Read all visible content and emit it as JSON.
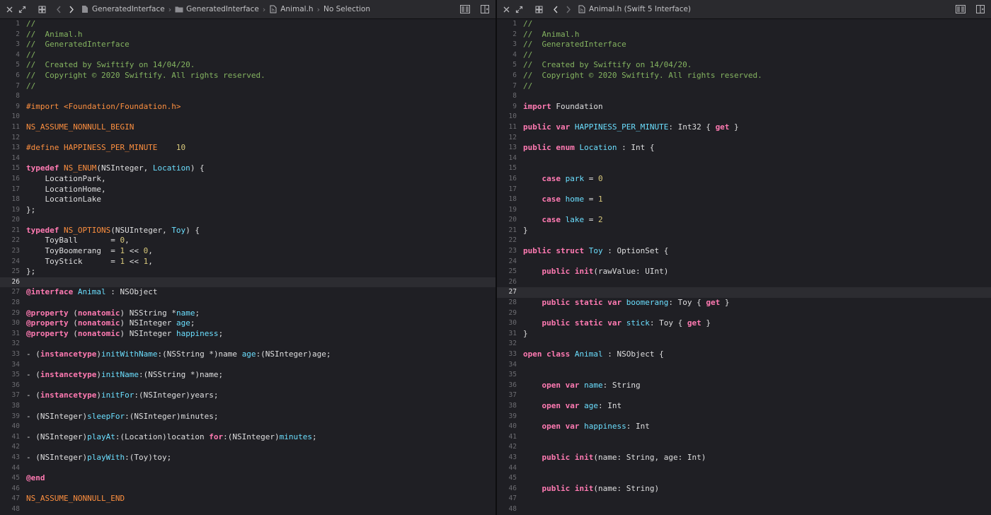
{
  "colors": {
    "background": "#1f1f24",
    "comment": "#84b360",
    "keyword": "#ff7ab2",
    "preprocessor": "#fd8f3f",
    "type": "#dabaff",
    "class": "#6bdfff",
    "number": "#d9c97c",
    "function": "#67b7a4"
  },
  "left": {
    "breadcrumbs": [
      "GeneratedInterface",
      "GeneratedInterface",
      "Animal.h",
      "No Selection"
    ],
    "current_line": 26,
    "lines": [
      {
        "n": "1",
        "s": [
          [
            "c",
            "//"
          ]
        ]
      },
      {
        "n": "2",
        "s": [
          [
            "c",
            "//  Animal.h"
          ]
        ]
      },
      {
        "n": "3",
        "s": [
          [
            "c",
            "//  GeneratedInterface"
          ]
        ]
      },
      {
        "n": "4",
        "s": [
          [
            "c",
            "//"
          ]
        ]
      },
      {
        "n": "5",
        "s": [
          [
            "c",
            "//  Created by Swiftify on 14/04/20."
          ]
        ]
      },
      {
        "n": "6",
        "s": [
          [
            "c",
            "//  Copyright © 2020 Swiftify. All rights reserved."
          ]
        ]
      },
      {
        "n": "7",
        "s": [
          [
            "c",
            "//"
          ]
        ]
      },
      {
        "n": "8",
        "s": []
      },
      {
        "n": "9",
        "s": [
          [
            "p",
            "#import <Foundation/Foundation.h>"
          ]
        ]
      },
      {
        "n": "10",
        "s": []
      },
      {
        "n": "11",
        "s": [
          [
            "p",
            "NS_ASSUME_NONNULL_BEGIN"
          ]
        ]
      },
      {
        "n": "12",
        "s": []
      },
      {
        "n": "13",
        "s": [
          [
            "p",
            "#define HAPPINESS_PER_MINUTE    "
          ],
          [
            "u",
            "10"
          ]
        ]
      },
      {
        "n": "14",
        "s": []
      },
      {
        "n": "15",
        "s": [
          [
            "k",
            "typedef"
          ],
          [
            "x",
            " "
          ],
          [
            "p",
            "NS_ENUM"
          ],
          [
            "x",
            "(NSInteger, "
          ],
          [
            "l",
            "Location"
          ],
          [
            "x",
            ") {"
          ]
        ]
      },
      {
        "n": "16",
        "s": [
          [
            "x",
            "    LocationPark,"
          ]
        ]
      },
      {
        "n": "17",
        "s": [
          [
            "x",
            "    LocationHome,"
          ]
        ]
      },
      {
        "n": "18",
        "s": [
          [
            "x",
            "    LocationLake"
          ]
        ]
      },
      {
        "n": "19",
        "s": [
          [
            "x",
            "};"
          ]
        ]
      },
      {
        "n": "20",
        "s": []
      },
      {
        "n": "21",
        "s": [
          [
            "k",
            "typedef"
          ],
          [
            "x",
            " "
          ],
          [
            "p",
            "NS_OPTIONS"
          ],
          [
            "x",
            "(NSUInteger, "
          ],
          [
            "l",
            "Toy"
          ],
          [
            "x",
            ") {"
          ]
        ]
      },
      {
        "n": "22",
        "s": [
          [
            "x",
            "    ToyBall       = "
          ],
          [
            "u",
            "0"
          ],
          [
            "x",
            ","
          ]
        ]
      },
      {
        "n": "23",
        "s": [
          [
            "x",
            "    ToyBoomerang  = "
          ],
          [
            "u",
            "1"
          ],
          [
            "x",
            " << "
          ],
          [
            "u",
            "0"
          ],
          [
            "x",
            ","
          ]
        ]
      },
      {
        "n": "24",
        "s": [
          [
            "x",
            "    ToyStick      = "
          ],
          [
            "u",
            "1"
          ],
          [
            "x",
            " << "
          ],
          [
            "u",
            "1"
          ],
          [
            "x",
            ","
          ]
        ]
      },
      {
        "n": "25",
        "s": [
          [
            "x",
            "};"
          ]
        ]
      },
      {
        "n": "26",
        "s": []
      },
      {
        "n": "27",
        "s": [
          [
            "k",
            "@interface"
          ],
          [
            "x",
            " "
          ],
          [
            "l",
            "Animal"
          ],
          [
            "x",
            " : NSObject"
          ]
        ]
      },
      {
        "n": "28",
        "s": []
      },
      {
        "n": "29",
        "s": [
          [
            "k",
            "@property"
          ],
          [
            "x",
            " ("
          ],
          [
            "k",
            "nonatomic"
          ],
          [
            "x",
            ") NSString *"
          ],
          [
            "l",
            "name"
          ],
          [
            "x",
            ";"
          ]
        ]
      },
      {
        "n": "30",
        "s": [
          [
            "k",
            "@property"
          ],
          [
            "x",
            " ("
          ],
          [
            "k",
            "nonatomic"
          ],
          [
            "x",
            ") NSInteger "
          ],
          [
            "l",
            "age"
          ],
          [
            "x",
            ";"
          ]
        ]
      },
      {
        "n": "31",
        "s": [
          [
            "k",
            "@property"
          ],
          [
            "x",
            " ("
          ],
          [
            "k",
            "nonatomic"
          ],
          [
            "x",
            ") NSInteger "
          ],
          [
            "l",
            "happiness"
          ],
          [
            "x",
            ";"
          ]
        ]
      },
      {
        "n": "32",
        "s": []
      },
      {
        "n": "33",
        "s": [
          [
            "x",
            "- ("
          ],
          [
            "k",
            "instancetype"
          ],
          [
            "x",
            ")"
          ],
          [
            "l",
            "initWithName"
          ],
          [
            "x",
            ":(NSString *)name "
          ],
          [
            "l",
            "age"
          ],
          [
            "x",
            ":(NSInteger)age;"
          ]
        ]
      },
      {
        "n": "34",
        "s": []
      },
      {
        "n": "35",
        "s": [
          [
            "x",
            "- ("
          ],
          [
            "k",
            "instancetype"
          ],
          [
            "x",
            ")"
          ],
          [
            "l",
            "initName"
          ],
          [
            "x",
            ":(NSString *)name;"
          ]
        ]
      },
      {
        "n": "36",
        "s": []
      },
      {
        "n": "37",
        "s": [
          [
            "x",
            "- ("
          ],
          [
            "k",
            "instancetype"
          ],
          [
            "x",
            ")"
          ],
          [
            "l",
            "initFor"
          ],
          [
            "x",
            ":(NSInteger)years;"
          ]
        ]
      },
      {
        "n": "38",
        "s": []
      },
      {
        "n": "39",
        "s": [
          [
            "x",
            "- (NSInteger)"
          ],
          [
            "l",
            "sleepFor"
          ],
          [
            "x",
            ":(NSInteger)minutes;"
          ]
        ]
      },
      {
        "n": "40",
        "s": []
      },
      {
        "n": "41",
        "s": [
          [
            "x",
            "- (NSInteger)"
          ],
          [
            "l",
            "playAt"
          ],
          [
            "x",
            ":(Location)location "
          ],
          [
            "k",
            "for"
          ],
          [
            "x",
            ":(NSInteger)"
          ],
          [
            "l",
            "minutes"
          ],
          [
            "x",
            ";"
          ]
        ]
      },
      {
        "n": "42",
        "s": []
      },
      {
        "n": "43",
        "s": [
          [
            "x",
            "- (NSInteger)"
          ],
          [
            "l",
            "playWith"
          ],
          [
            "x",
            ":(Toy)toy;"
          ]
        ]
      },
      {
        "n": "44",
        "s": []
      },
      {
        "n": "45",
        "s": [
          [
            "k",
            "@end"
          ]
        ]
      },
      {
        "n": "46",
        "s": []
      },
      {
        "n": "47",
        "s": [
          [
            "p",
            "NS_ASSUME_NONNULL_END"
          ]
        ]
      },
      {
        "n": "48",
        "s": []
      }
    ]
  },
  "right": {
    "breadcrumbs": [
      "Animal.h (Swift 5 Interface)"
    ],
    "current_line": 27,
    "lines": [
      {
        "n": "1",
        "s": [
          [
            "c",
            "//"
          ]
        ]
      },
      {
        "n": "2",
        "s": [
          [
            "c",
            "//  Animal.h"
          ]
        ]
      },
      {
        "n": "3",
        "s": [
          [
            "c",
            "//  GeneratedInterface"
          ]
        ]
      },
      {
        "n": "4",
        "s": [
          [
            "c",
            "//"
          ]
        ]
      },
      {
        "n": "5",
        "s": [
          [
            "c",
            "//  Created by Swiftify on 14/04/20."
          ]
        ]
      },
      {
        "n": "6",
        "s": [
          [
            "c",
            "//  Copyright © 2020 Swiftify. All rights reserved."
          ]
        ]
      },
      {
        "n": "7",
        "s": [
          [
            "c",
            "//"
          ]
        ]
      },
      {
        "n": "8",
        "s": []
      },
      {
        "n": "9",
        "s": [
          [
            "k",
            "import"
          ],
          [
            "x",
            " Foundation"
          ]
        ]
      },
      {
        "n": "10",
        "s": []
      },
      {
        "n": "11",
        "s": [
          [
            "k",
            "public"
          ],
          [
            "x",
            " "
          ],
          [
            "k",
            "var"
          ],
          [
            "x",
            " "
          ],
          [
            "l",
            "HAPPINESS_PER_MINUTE"
          ],
          [
            "x",
            ": Int32 { "
          ],
          [
            "k",
            "get"
          ],
          [
            "x",
            " }"
          ]
        ]
      },
      {
        "n": "12",
        "s": []
      },
      {
        "n": "13",
        "s": [
          [
            "k",
            "public"
          ],
          [
            "x",
            " "
          ],
          [
            "k",
            "enum"
          ],
          [
            "x",
            " "
          ],
          [
            "l",
            "Location"
          ],
          [
            "x",
            " : Int {"
          ]
        ]
      },
      {
        "n": "14",
        "s": []
      },
      {
        "n": "15",
        "s": []
      },
      {
        "n": "16",
        "s": [
          [
            "x",
            "    "
          ],
          [
            "k",
            "case"
          ],
          [
            "x",
            " "
          ],
          [
            "l",
            "park"
          ],
          [
            "x",
            " = "
          ],
          [
            "u",
            "0"
          ]
        ]
      },
      {
        "n": "17",
        "s": []
      },
      {
        "n": "18",
        "s": [
          [
            "x",
            "    "
          ],
          [
            "k",
            "case"
          ],
          [
            "x",
            " "
          ],
          [
            "l",
            "home"
          ],
          [
            "x",
            " = "
          ],
          [
            "u",
            "1"
          ]
        ]
      },
      {
        "n": "19",
        "s": []
      },
      {
        "n": "20",
        "s": [
          [
            "x",
            "    "
          ],
          [
            "k",
            "case"
          ],
          [
            "x",
            " "
          ],
          [
            "l",
            "lake"
          ],
          [
            "x",
            " = "
          ],
          [
            "u",
            "2"
          ]
        ]
      },
      {
        "n": "21",
        "s": [
          [
            "x",
            "}"
          ]
        ]
      },
      {
        "n": "22",
        "s": []
      },
      {
        "n": "23",
        "s": [
          [
            "k",
            "public"
          ],
          [
            "x",
            " "
          ],
          [
            "k",
            "struct"
          ],
          [
            "x",
            " "
          ],
          [
            "l",
            "Toy"
          ],
          [
            "x",
            " : OptionSet {"
          ]
        ]
      },
      {
        "n": "24",
        "s": []
      },
      {
        "n": "25",
        "s": [
          [
            "x",
            "    "
          ],
          [
            "k",
            "public"
          ],
          [
            "x",
            " "
          ],
          [
            "k",
            "init"
          ],
          [
            "x",
            "(rawValue: UInt)"
          ]
        ]
      },
      {
        "n": "26",
        "s": []
      },
      {
        "n": "27",
        "s": []
      },
      {
        "n": "28",
        "s": [
          [
            "x",
            "    "
          ],
          [
            "k",
            "public"
          ],
          [
            "x",
            " "
          ],
          [
            "k",
            "static"
          ],
          [
            "x",
            " "
          ],
          [
            "k",
            "var"
          ],
          [
            "x",
            " "
          ],
          [
            "l",
            "boomerang"
          ],
          [
            "x",
            ": Toy { "
          ],
          [
            "k",
            "get"
          ],
          [
            "x",
            " }"
          ]
        ]
      },
      {
        "n": "29",
        "s": []
      },
      {
        "n": "30",
        "s": [
          [
            "x",
            "    "
          ],
          [
            "k",
            "public"
          ],
          [
            "x",
            " "
          ],
          [
            "k",
            "static"
          ],
          [
            "x",
            " "
          ],
          [
            "k",
            "var"
          ],
          [
            "x",
            " "
          ],
          [
            "l",
            "stick"
          ],
          [
            "x",
            ": Toy { "
          ],
          [
            "k",
            "get"
          ],
          [
            "x",
            " }"
          ]
        ]
      },
      {
        "n": "31",
        "s": [
          [
            "x",
            "}"
          ]
        ]
      },
      {
        "n": "32",
        "s": []
      },
      {
        "n": "33",
        "s": [
          [
            "k",
            "open"
          ],
          [
            "x",
            " "
          ],
          [
            "k",
            "class"
          ],
          [
            "x",
            " "
          ],
          [
            "l",
            "Animal"
          ],
          [
            "x",
            " : NSObject {"
          ]
        ]
      },
      {
        "n": "34",
        "s": []
      },
      {
        "n": "35",
        "s": []
      },
      {
        "n": "36",
        "s": [
          [
            "x",
            "    "
          ],
          [
            "k",
            "open"
          ],
          [
            "x",
            " "
          ],
          [
            "k",
            "var"
          ],
          [
            "x",
            " "
          ],
          [
            "l",
            "name"
          ],
          [
            "x",
            ": String"
          ]
        ]
      },
      {
        "n": "37",
        "s": []
      },
      {
        "n": "38",
        "s": [
          [
            "x",
            "    "
          ],
          [
            "k",
            "open"
          ],
          [
            "x",
            " "
          ],
          [
            "k",
            "var"
          ],
          [
            "x",
            " "
          ],
          [
            "l",
            "age"
          ],
          [
            "x",
            ": Int"
          ]
        ]
      },
      {
        "n": "39",
        "s": []
      },
      {
        "n": "40",
        "s": [
          [
            "x",
            "    "
          ],
          [
            "k",
            "open"
          ],
          [
            "x",
            " "
          ],
          [
            "k",
            "var"
          ],
          [
            "x",
            " "
          ],
          [
            "l",
            "happiness"
          ],
          [
            "x",
            ": Int"
          ]
        ]
      },
      {
        "n": "41",
        "s": []
      },
      {
        "n": "42",
        "s": []
      },
      {
        "n": "43",
        "s": [
          [
            "x",
            "    "
          ],
          [
            "k",
            "public"
          ],
          [
            "x",
            " "
          ],
          [
            "k",
            "init"
          ],
          [
            "x",
            "(name: String, age: Int)"
          ]
        ]
      },
      {
        "n": "44",
        "s": []
      },
      {
        "n": "45",
        "s": []
      },
      {
        "n": "46",
        "s": [
          [
            "x",
            "    "
          ],
          [
            "k",
            "public"
          ],
          [
            "x",
            " "
          ],
          [
            "k",
            "init"
          ],
          [
            "x",
            "(name: String)"
          ]
        ]
      },
      {
        "n": "47",
        "s": []
      },
      {
        "n": "48",
        "s": []
      }
    ]
  }
}
